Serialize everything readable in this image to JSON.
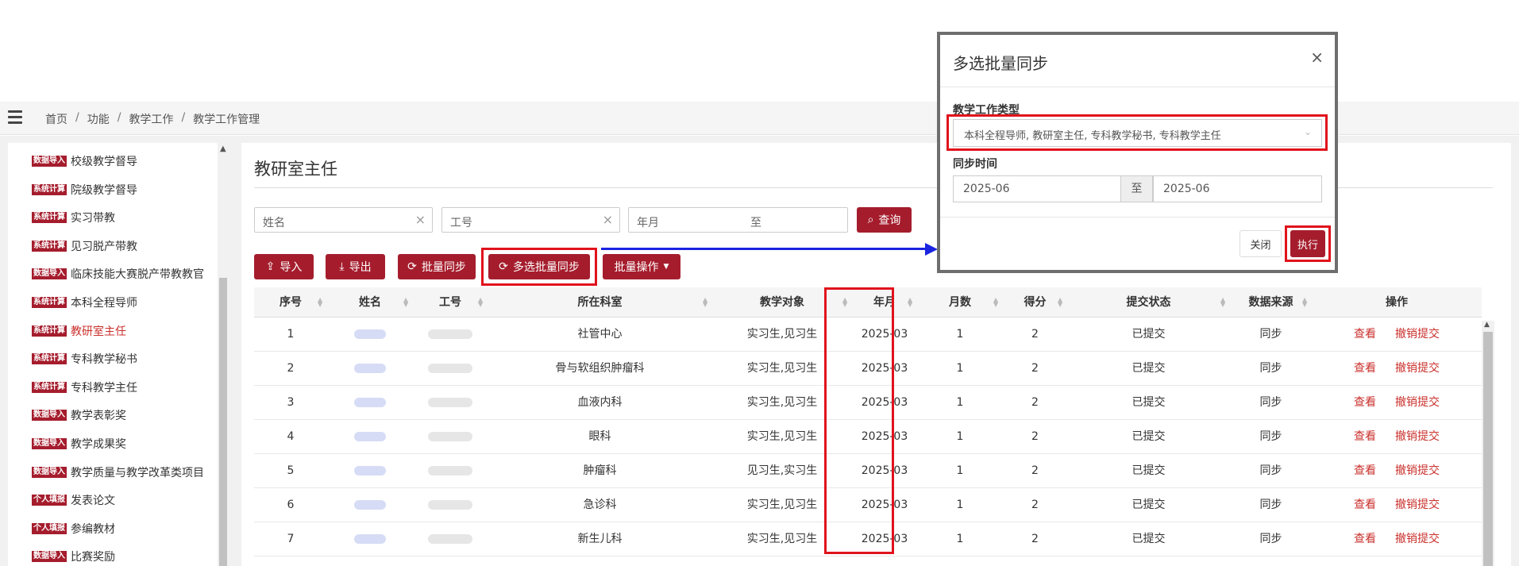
{
  "breadcrumb": [
    "首页",
    "功能",
    "教学工作",
    "教学工作管理"
  ],
  "sidebar": {
    "items": [
      {
        "tag": "数据导入",
        "label": "校级教学督导"
      },
      {
        "tag": "系统计算",
        "label": "院级教学督导"
      },
      {
        "tag": "系统计算",
        "label": "实习带教"
      },
      {
        "tag": "系统计算",
        "label": "见习脱产带教"
      },
      {
        "tag": "数据导入",
        "label": "临床技能大赛脱产带教教官"
      },
      {
        "tag": "系统计算",
        "label": "本科全程导师"
      },
      {
        "tag": "系统计算",
        "label": "教研室主任"
      },
      {
        "tag": "系统计算",
        "label": "专科教学秘书"
      },
      {
        "tag": "系统计算",
        "label": "专科教学主任"
      },
      {
        "tag": "数据导入",
        "label": "教学表彰奖"
      },
      {
        "tag": "数据导入",
        "label": "教学成果奖"
      },
      {
        "tag": "数据导入",
        "label": "教学质量与教学改革类项目"
      },
      {
        "tag": "个人填报",
        "label": "发表论文"
      },
      {
        "tag": "个人填报",
        "label": "参编教材"
      },
      {
        "tag": "数据导入",
        "label": "比赛奖励"
      }
    ],
    "active_index": 6
  },
  "page": {
    "title": "教研室主任"
  },
  "filters": {
    "name_placeholder": "姓名",
    "id_placeholder": "工号",
    "month_placeholder": "年月",
    "to": "至",
    "query": "查询"
  },
  "toolbar": {
    "import": "导入",
    "export": "导出",
    "batch_sync": "批量同步",
    "multi_sync": "多选批量同步",
    "batch_ops": "批量操作"
  },
  "table": {
    "headers": [
      "序号",
      "姓名",
      "工号",
      "所在科室",
      "教学对象",
      "年月",
      "月数",
      "得分",
      "提交状态",
      "数据来源",
      "操作"
    ],
    "rows": [
      {
        "no": "1",
        "dept": "社管中心",
        "target": "实习生,见习生",
        "month": "2025-03",
        "count": "1",
        "score": "2",
        "status": "已提交",
        "source": "同步"
      },
      {
        "no": "2",
        "dept": "骨与软组织肿瘤科",
        "target": "实习生,见习生",
        "month": "2025-03",
        "count": "1",
        "score": "2",
        "status": "已提交",
        "source": "同步"
      },
      {
        "no": "3",
        "dept": "血液内科",
        "target": "实习生,见习生",
        "month": "2025-03",
        "count": "1",
        "score": "2",
        "status": "已提交",
        "source": "同步"
      },
      {
        "no": "4",
        "dept": "眼科",
        "target": "实习生,见习生",
        "month": "2025-03",
        "count": "1",
        "score": "2",
        "status": "已提交",
        "source": "同步"
      },
      {
        "no": "5",
        "dept": "肿瘤科",
        "target": "见习生,实习生",
        "month": "2025-03",
        "count": "1",
        "score": "2",
        "status": "已提交",
        "source": "同步"
      },
      {
        "no": "6",
        "dept": "急诊科",
        "target": "实习生,见习生",
        "month": "2025-03",
        "count": "1",
        "score": "2",
        "status": "已提交",
        "source": "同步"
      },
      {
        "no": "7",
        "dept": "新生儿科",
        "target": "实习生,见习生",
        "month": "2025-03",
        "count": "1",
        "score": "2",
        "status": "已提交",
        "source": "同步"
      }
    ],
    "actions": {
      "view": "查看",
      "revoke": "撤销提交"
    }
  },
  "modal": {
    "title": "多选批量同步",
    "close_icon": "×",
    "type_label": "教学工作类型",
    "type_value": "本科全程导师, 教研室主任, 专科教学秘书, 专科教学主任",
    "time_label": "同步时间",
    "from": "2025-06",
    "to_label": "至",
    "to": "2025-06",
    "cancel": "关闭",
    "execute": "执行"
  },
  "colors": {
    "primary": "#a51d2d",
    "highlight": "#e0131c",
    "arrow": "#1a24e0",
    "link": "#c9302c"
  }
}
